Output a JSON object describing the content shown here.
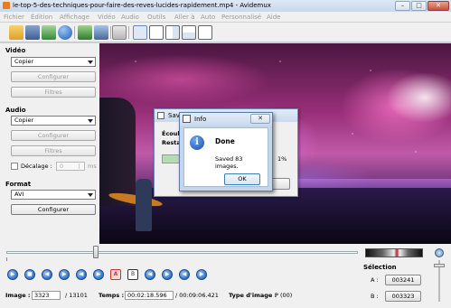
{
  "window": {
    "title": "le-top-5-des-techniques-pour-faire-des-reves-lucides-rapidement.mp4 - Avidemux",
    "minimize": "–",
    "maximize": "□",
    "close": "✕"
  },
  "menu": [
    "Fichier",
    "Édition",
    "Affichage",
    "Vidéo",
    "Audio",
    "Outils",
    "Aller à",
    "Auto",
    "Personnalisé",
    "Aide"
  ],
  "left_panel": {
    "video": {
      "title": "Vidéo",
      "codec": "Copier",
      "configure": "Configurer",
      "filters": "Filtres"
    },
    "audio": {
      "title": "Audio",
      "codec": "Copier",
      "configure": "Configurer",
      "filters": "Filtres",
      "shift_label": "Décalage :",
      "shift_value": "0",
      "shift_unit": "ms"
    },
    "format": {
      "title": "Format",
      "value": "AVI",
      "configure": "Configurer"
    }
  },
  "saving_dialog": {
    "title": "Sav",
    "label1": "Écoul",
    "label2": "Resta",
    "percent": "1%"
  },
  "info_dialog": {
    "title": "Info",
    "heading": "Done",
    "message": "Saved 83 images.",
    "ok": "OK",
    "close": "✕"
  },
  "status": {
    "image_label": "Image :",
    "image_value": "3323",
    "image_total": "/ 13101",
    "time_label": "Temps :",
    "time_value": "00:02:18.596",
    "time_total": "/ 00:09:06.421",
    "type_label": "Type d'image :",
    "type_value": "P (00)"
  },
  "selection": {
    "title": "Sélection",
    "a_label": "A :",
    "a_value": "003241",
    "b_label": "B :",
    "b_value": "003323"
  },
  "playback": {
    "position_fraction": 0.255
  },
  "colors": {
    "accent": "#2f6fc2",
    "titlebar": "#c8d8ec",
    "close": "#c8523a"
  }
}
